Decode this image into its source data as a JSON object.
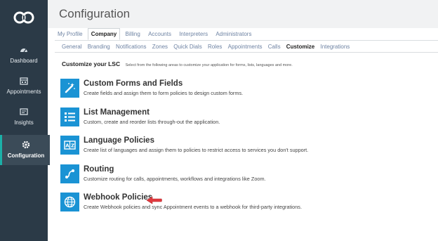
{
  "sidebar": {
    "items": [
      {
        "label": "Dashboard",
        "icon": "dashboard-icon"
      },
      {
        "label": "Appointments",
        "icon": "calendar-icon"
      },
      {
        "label": "Insights",
        "icon": "chart-icon"
      },
      {
        "label": "Configuration",
        "icon": "gear-icon",
        "active": true
      }
    ],
    "accent": "#1bb0a8"
  },
  "header": {
    "title": "Configuration"
  },
  "tabs_primary": [
    "My Profile",
    "Company",
    "Billing",
    "Accounts",
    "Interpreters",
    "Administrators"
  ],
  "tabs_primary_active": "Company",
  "tabs_secondary": [
    "General",
    "Branding",
    "Notifications",
    "Zones",
    "Quick Dials",
    "Roles",
    "Appointments",
    "Calls",
    "Customize",
    "Integrations"
  ],
  "tabs_secondary_active": "Customize",
  "customize": {
    "title": "Customize your LSC",
    "subtitle": "Select from the following areas to customize your application for forms, lists, languages and more."
  },
  "options": [
    {
      "title": "Custom Forms and Fields",
      "desc": "Create fields and assign them to form policies to design custom forms.",
      "icon": "magic-wand-icon"
    },
    {
      "title": "List Management",
      "desc": "Custom, create and reorder lists through-out the application.",
      "icon": "list-icon"
    },
    {
      "title": "Language Policies",
      "desc": "Create list of languages and assign them to policies to restrict access to services you don't support.",
      "icon": "translate-icon"
    },
    {
      "title": "Routing",
      "desc": "Customize routing for calls, appointments, workflows and integrations like Zoom.",
      "icon": "route-icon"
    },
    {
      "title": "Webhook Policies",
      "desc": "Create Webhook policies and sync Appointment events to a webhook for third-party integrations.",
      "icon": "globe-icon"
    }
  ],
  "colors": {
    "icon_box": "#1a93d4",
    "sidebar_bg": "#2b3a47",
    "arrow": "#e0393e"
  }
}
